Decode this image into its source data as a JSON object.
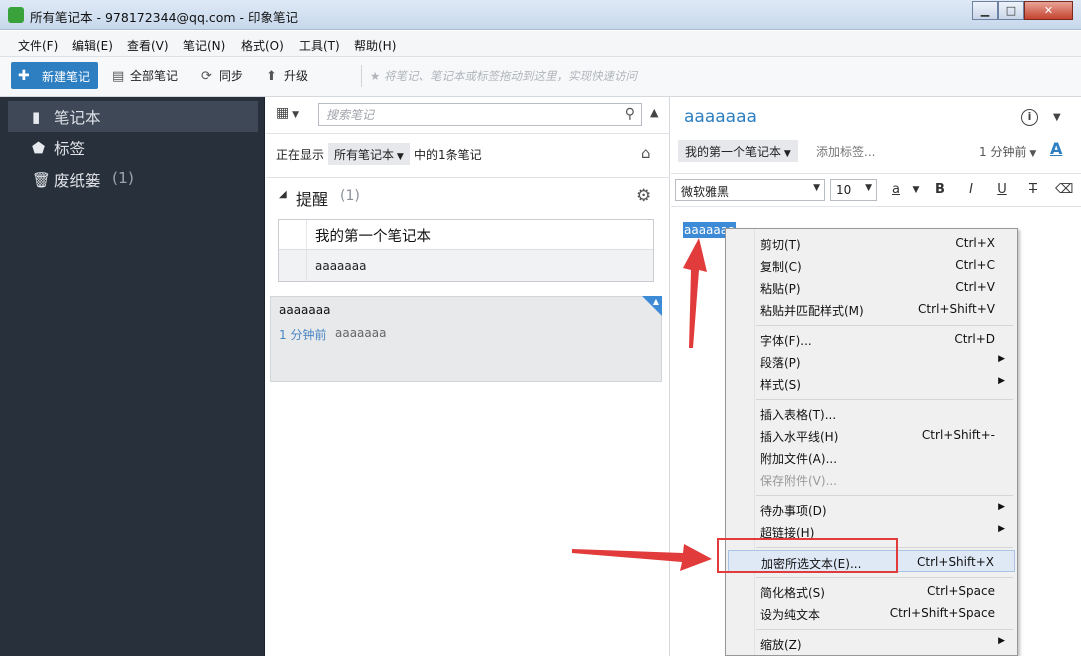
{
  "window": {
    "title": "所有笔记本 - 978172344@qq.com - 印象笔记",
    "minimize": "▁",
    "maximize": "□",
    "close": "✕"
  },
  "menu": [
    "文件(F)",
    "编辑(E)",
    "查看(V)",
    "笔记(N)",
    "格式(O)",
    "工具(T)",
    "帮助(H)"
  ],
  "toolbar": {
    "new_note": "新建笔记",
    "all_notes": "全部笔记",
    "sync": "同步",
    "upgrade": "升级",
    "shortcut_hint": "将笔记、笔记本或标签拖动到这里，实现快速访问"
  },
  "sidebar": {
    "items": [
      {
        "label": "笔记本",
        "icon": "notebook-icon"
      },
      {
        "label": "标签",
        "icon": "tag-icon"
      },
      {
        "label": "废纸篓",
        "icon": "trash-icon",
        "count": "(1)"
      }
    ]
  },
  "notelist": {
    "search_placeholder": "搜索笔记",
    "showing_prefix": "正在显示",
    "notebook_filter": "所有笔记本",
    "showing_suffix": "中的1条笔记",
    "reminder_label": "提醒",
    "reminder_count": "(1)",
    "reminder_notebook": "我的第一个笔记本",
    "reminder_note": "aaaaaaa",
    "note": {
      "title": "aaaaaaa",
      "time": "1 分钟前",
      "snippet": "aaaaaaa"
    }
  },
  "editor": {
    "title": "aaaaaaa",
    "notebook": "我的第一个笔记本",
    "add_tag": "添加标签...",
    "time": "1 分钟前",
    "font": "微软雅黑",
    "size": "10",
    "selected_text": "aaaaaaa",
    "fmt": {
      "color": "a",
      "bold": "B",
      "italic": "I",
      "underline": "U",
      "strike": "T",
      "clear": "⌫"
    }
  },
  "context_menu": {
    "items": [
      {
        "label": "剪切(T)",
        "shortcut": "Ctrl+X"
      },
      {
        "label": "复制(C)",
        "shortcut": "Ctrl+C"
      },
      {
        "label": "粘贴(P)",
        "shortcut": "Ctrl+V"
      },
      {
        "label": "粘贴并匹配样式(M)",
        "shortcut": "Ctrl+Shift+V"
      },
      {
        "label": "字体(F)...",
        "shortcut": "Ctrl+D"
      },
      {
        "label": "段落(P)",
        "shortcut": ""
      },
      {
        "label": "样式(S)",
        "shortcut": ""
      },
      {
        "label": "插入表格(T)...",
        "shortcut": ""
      },
      {
        "label": "插入水平线(H)",
        "shortcut": "Ctrl+Shift+-"
      },
      {
        "label": "附加文件(A)...",
        "shortcut": ""
      },
      {
        "label": "保存附件(V)...",
        "shortcut": ""
      },
      {
        "label": "待办事项(D)",
        "shortcut": ""
      },
      {
        "label": "超链接(H)",
        "shortcut": ""
      },
      {
        "label": "加密所选文本(E)...",
        "shortcut": "Ctrl+Shift+X"
      },
      {
        "label": "简化格式(S)",
        "shortcut": "Ctrl+Space"
      },
      {
        "label": "设为纯文本",
        "shortcut": "Ctrl+Shift+Space"
      },
      {
        "label": "缩放(Z)",
        "shortcut": ""
      }
    ]
  },
  "colors": {
    "accent": "#2e7fc2",
    "sidebar": "#28303b",
    "annotation": "#e23b3b"
  }
}
